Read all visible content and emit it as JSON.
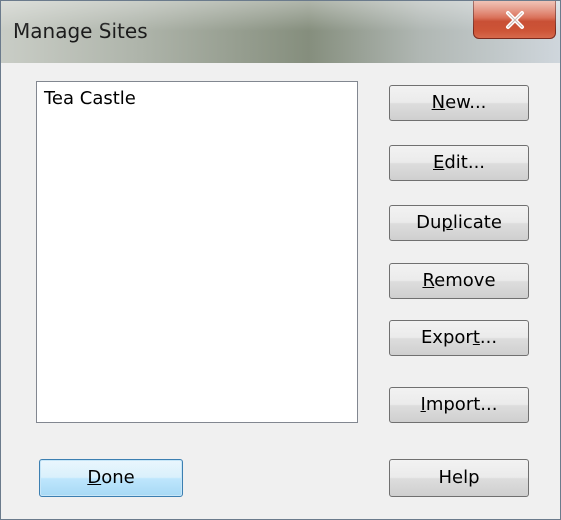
{
  "window": {
    "title": "Manage Sites"
  },
  "sites_list": {
    "items": [
      "Tea Castle"
    ]
  },
  "buttons": {
    "new": {
      "pre": "",
      "mnemonic": "N",
      "post": "ew..."
    },
    "edit": {
      "pre": "",
      "mnemonic": "E",
      "post": "dit..."
    },
    "duplicate": {
      "pre": "Du",
      "mnemonic": "p",
      "post": "licate"
    },
    "remove": {
      "pre": "",
      "mnemonic": "R",
      "post": "emove"
    },
    "export": {
      "pre": "Expor",
      "mnemonic": "t",
      "post": "..."
    },
    "import": {
      "pre": "",
      "mnemonic": "I",
      "post": "mport..."
    },
    "done": {
      "pre": "",
      "mnemonic": "D",
      "post": "one"
    },
    "help": {
      "label": "Help"
    }
  },
  "icons": {
    "close": "close-icon"
  },
  "colors": {
    "close_button": "#c9452a",
    "dialog_background": "#f0f0f0",
    "default_button_border": "#3c7fb1"
  }
}
